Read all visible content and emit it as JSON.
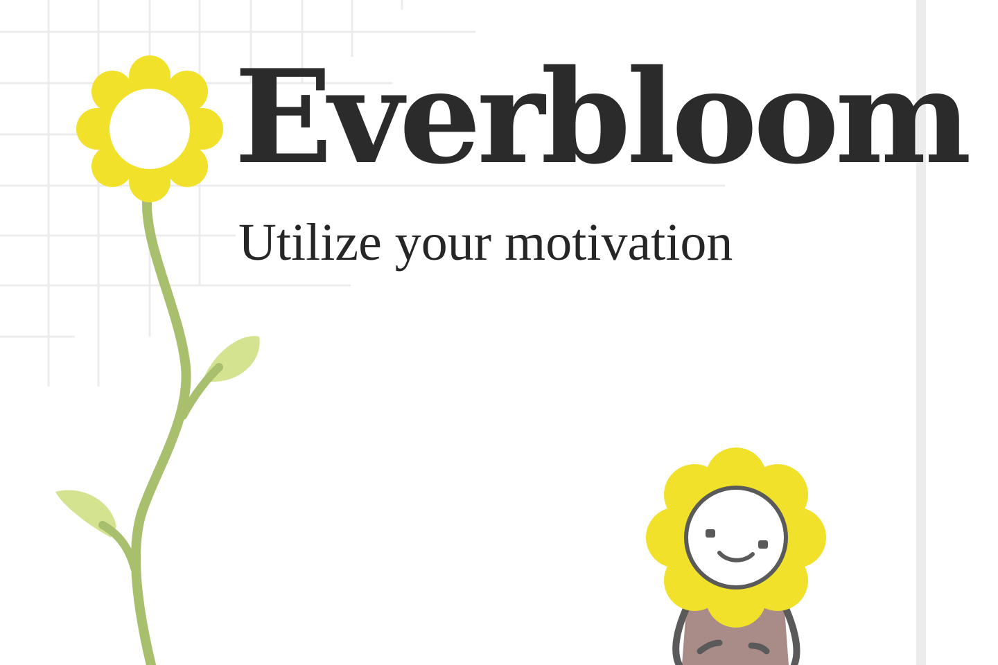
{
  "brand": {
    "name": "Everbloom",
    "tagline": "Utilize your motivation"
  },
  "colors": {
    "background": "#ffffff",
    "grid_line": "#ececec",
    "text": "#2b2b2b",
    "petal": "#f2e12b",
    "flower_center": "#ffffff",
    "stem": "#a8bf6e",
    "leaf": "#d3e38f",
    "face_outline": "#5a5a5a",
    "mascot_body": "#a98b88"
  },
  "icons": {
    "logo": "flower-icon",
    "mascot": "smiling-flower-mascot"
  }
}
